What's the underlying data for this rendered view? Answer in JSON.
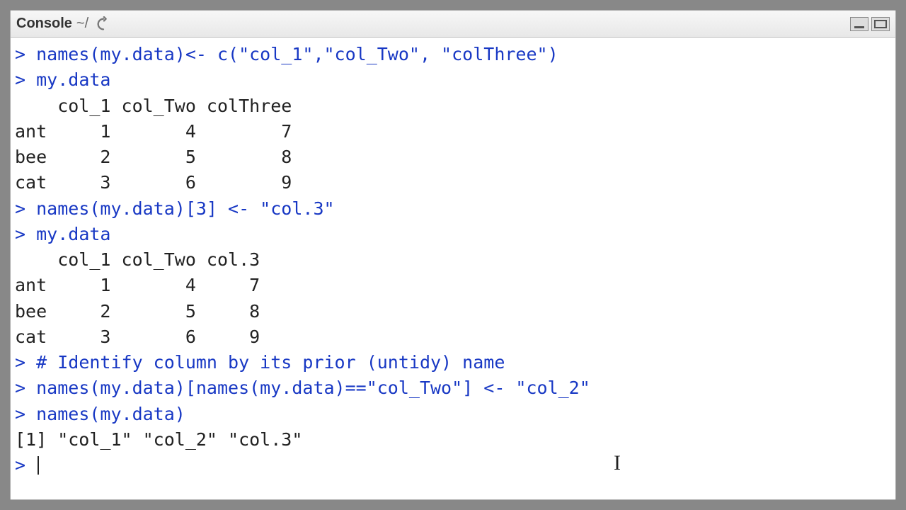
{
  "titlebar": {
    "title": "Console",
    "path": "~/",
    "popout_icon": "popout-icon",
    "min_icon": "minimize-icon",
    "max_icon": "maximize-icon"
  },
  "console": {
    "lines": [
      {
        "type": "cmd",
        "text": "names(my.data)<- c(\"col_1\",\"col_Two\", \"colThree\")"
      },
      {
        "type": "cmd",
        "text": "my.data"
      },
      {
        "type": "out",
        "text": "    col_1 col_Two colThree"
      },
      {
        "type": "out",
        "text": "ant     1       4        7"
      },
      {
        "type": "out",
        "text": "bee     2       5        8"
      },
      {
        "type": "out",
        "text": "cat     3       6        9"
      },
      {
        "type": "cmd",
        "text": "names(my.data)[3] <- \"col.3\""
      },
      {
        "type": "cmd",
        "text": "my.data"
      },
      {
        "type": "out",
        "text": "    col_1 col_Two col.3"
      },
      {
        "type": "out",
        "text": "ant     1       4     7"
      },
      {
        "type": "out",
        "text": "bee     2       5     8"
      },
      {
        "type": "out",
        "text": "cat     3       6     9"
      },
      {
        "type": "cmd",
        "text": "# Identify column by its prior (untidy) name"
      },
      {
        "type": "cmd",
        "text": "names(my.data)[names(my.data)==\"col_Two\"] <- \"col_2\""
      },
      {
        "type": "cmd",
        "text": "names(my.data)"
      },
      {
        "type": "out",
        "text": "[1] \"col_1\" \"col_2\" \"col.3\""
      }
    ],
    "prompt_char": ">",
    "active_prompt": "> "
  }
}
